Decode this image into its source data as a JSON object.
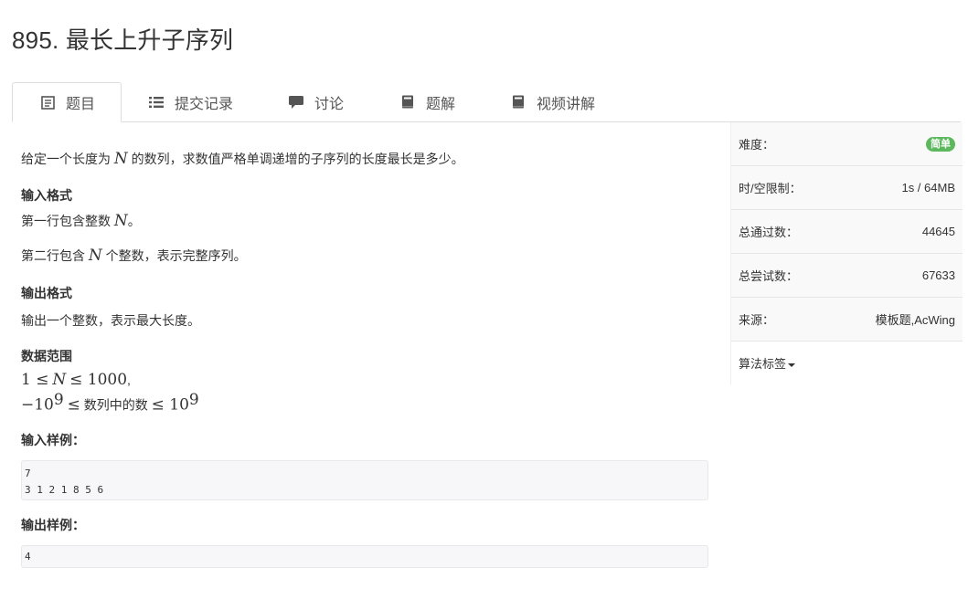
{
  "problem": {
    "title": "895. 最长上升子序列"
  },
  "tabs": [
    {
      "label": "题目",
      "icon": "document-icon"
    },
    {
      "label": "提交记录",
      "icon": "list-icon"
    },
    {
      "label": "讨论",
      "icon": "comment-icon"
    },
    {
      "label": "题解",
      "icon": "book-icon"
    },
    {
      "label": "视频讲解",
      "icon": "book-icon"
    }
  ],
  "description": {
    "intro_a": "给定一个长度为",
    "intro_var": "N",
    "intro_b": "的数列，求数值严格单调递增的子序列的长度最长是多少。",
    "input_heading": "输入格式",
    "input_line1_a": "第一行包含整数",
    "input_line1_var": "N",
    "input_line1_b": "。",
    "input_line2_a": "第二行包含",
    "input_line2_var": "N",
    "input_line2_b": "个整数，表示完整序列。",
    "output_heading": "输出格式",
    "output_line": "输出一个整数，表示最大长度。",
    "range_heading": "数据范围",
    "range_line1_a": "1 ≤",
    "range_line1_var": "N",
    "range_line1_b": "≤ 1000",
    "range_line1_c": ",",
    "range_line2_a": "−10",
    "range_line2_sup": "9",
    "range_line2_b": "≤",
    "range_line2_c": "数列中的数",
    "range_line2_d": "≤ 10",
    "range_line2_sup2": "9",
    "sample_input_heading": "输入样例：",
    "sample_input": "7\n3 1 2 1 8 5 6",
    "sample_output_heading": "输出样例：",
    "sample_output": "4"
  },
  "sidebar": {
    "difficulty_label": "难度：",
    "difficulty_value": "简单",
    "limit_label": "时/空限制：",
    "limit_value": "1s / 64MB",
    "passed_label": "总通过数：",
    "passed_value": "44645",
    "attempts_label": "总尝试数：",
    "attempts_value": "67633",
    "source_label": "来源：",
    "source_value": "模板题,AcWing",
    "tags_label": "算法标签"
  },
  "colors": {
    "badge_green": "#5cb85c",
    "border": "#dddddd",
    "code_bg": "#f7f7f9"
  }
}
